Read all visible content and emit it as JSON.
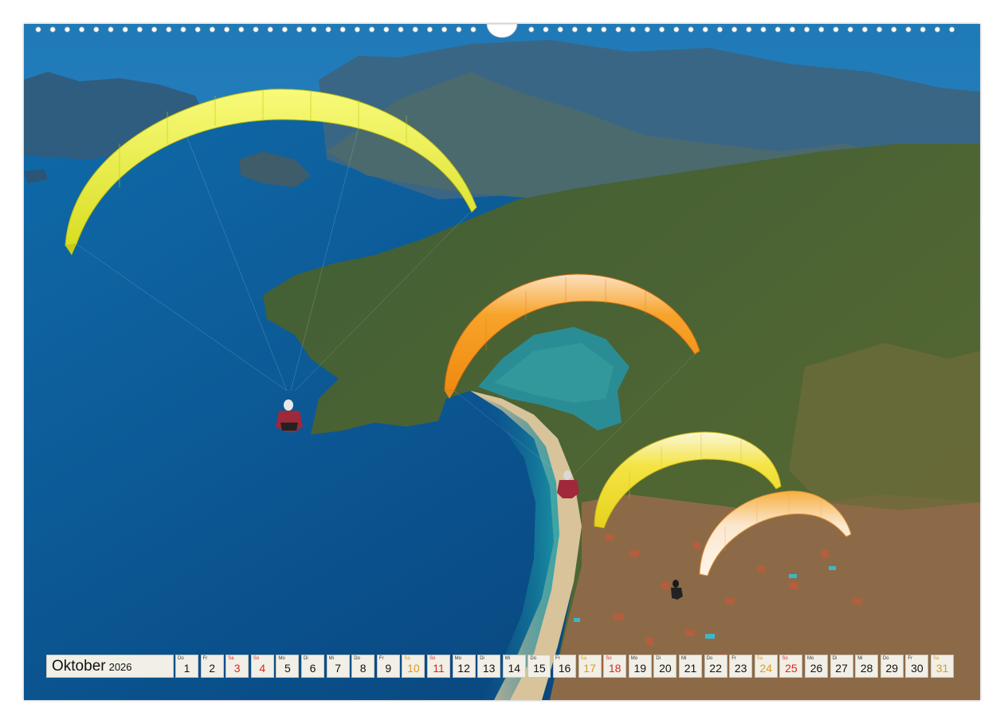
{
  "calendar": {
    "month": "Oktober",
    "year": "2026",
    "days": [
      {
        "wd": "Do",
        "num": "1",
        "type": "weekday"
      },
      {
        "wd": "Fr",
        "num": "2",
        "type": "weekday"
      },
      {
        "wd": "Sa",
        "num": "3",
        "type": "sun"
      },
      {
        "wd": "So",
        "num": "4",
        "type": "sun"
      },
      {
        "wd": "Mo",
        "num": "5",
        "type": "weekday"
      },
      {
        "wd": "Di",
        "num": "6",
        "type": "weekday"
      },
      {
        "wd": "Mi",
        "num": "7",
        "type": "weekday"
      },
      {
        "wd": "Do",
        "num": "8",
        "type": "weekday"
      },
      {
        "wd": "Fr",
        "num": "9",
        "type": "weekday"
      },
      {
        "wd": "Sa",
        "num": "10",
        "type": "sat"
      },
      {
        "wd": "So",
        "num": "11",
        "type": "sun"
      },
      {
        "wd": "Mo",
        "num": "12",
        "type": "weekday"
      },
      {
        "wd": "Di",
        "num": "13",
        "type": "weekday"
      },
      {
        "wd": "Mi",
        "num": "14",
        "type": "weekday"
      },
      {
        "wd": "Do",
        "num": "15",
        "type": "weekday"
      },
      {
        "wd": "Fr",
        "num": "16",
        "type": "weekday"
      },
      {
        "wd": "Sa",
        "num": "17",
        "type": "sat"
      },
      {
        "wd": "So",
        "num": "18",
        "type": "sun"
      },
      {
        "wd": "Mo",
        "num": "19",
        "type": "weekday"
      },
      {
        "wd": "Di",
        "num": "20",
        "type": "weekday"
      },
      {
        "wd": "Mi",
        "num": "21",
        "type": "weekday"
      },
      {
        "wd": "Do",
        "num": "22",
        "type": "weekday"
      },
      {
        "wd": "Fr",
        "num": "23",
        "type": "weekday"
      },
      {
        "wd": "Sa",
        "num": "24",
        "type": "sat"
      },
      {
        "wd": "So",
        "num": "25",
        "type": "sun"
      },
      {
        "wd": "Mo",
        "num": "26",
        "type": "weekday"
      },
      {
        "wd": "Di",
        "num": "27",
        "type": "weekday"
      },
      {
        "wd": "Mi",
        "num": "28",
        "type": "weekday"
      },
      {
        "wd": "Do",
        "num": "29",
        "type": "weekday"
      },
      {
        "wd": "Fr",
        "num": "30",
        "type": "weekday"
      },
      {
        "wd": "Sa",
        "num": "31",
        "type": "sat"
      }
    ]
  },
  "photo": {
    "subject": "paragliders-over-lagoon-coast",
    "canopies": [
      {
        "name": "yellow-canopy-large",
        "color": "#e8ec3a"
      },
      {
        "name": "orange-canopy",
        "color": "#f5a020"
      },
      {
        "name": "yellow-canopy-small",
        "color": "#f0e23a"
      },
      {
        "name": "orange-white-canopy",
        "color": "#f2a838"
      }
    ]
  },
  "colors": {
    "sea_deep": "#0a4f8a",
    "sea_mid": "#1470b0",
    "lagoon": "#2a9a9a",
    "land_green": "#3f5a2a",
    "mountain_blue": "#3d6b8f",
    "beach": "#d8c39a",
    "weekend_saturday": "#e09a1e",
    "weekend_sunday": "#d8281e"
  }
}
